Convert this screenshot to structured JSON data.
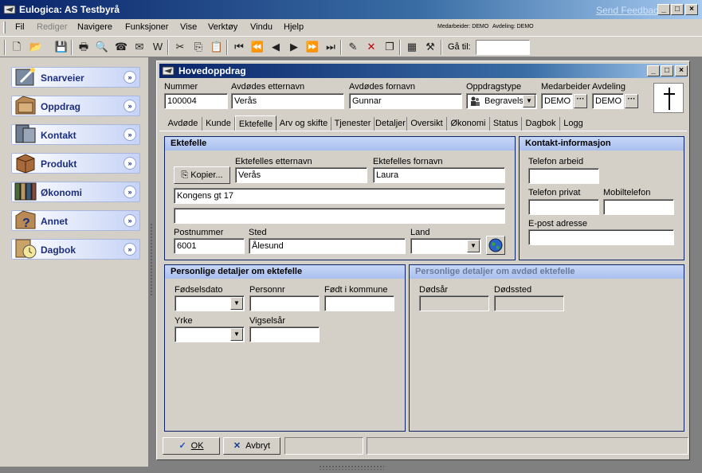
{
  "window": {
    "title": "Eulogica: AS Testbyrå",
    "feedback_link": "Send Feedback"
  },
  "menu": {
    "items": [
      "Fil",
      "Rediger",
      "Navigere",
      "Funksjoner",
      "Vise",
      "Verktøy",
      "Vindu",
      "Hjelp"
    ],
    "medarbeider_status": "Medarbeider: DEMO",
    "avdeling_status": "Avdeling: DEMO"
  },
  "toolbar": {
    "goto_label": "Gå til:",
    "goto_value": ""
  },
  "nav": {
    "items": [
      "Snarveier",
      "Oppdrag",
      "Kontakt",
      "Produkt",
      "Økonomi",
      "Annet",
      "Dagbok"
    ]
  },
  "child": {
    "title": "Hovedoppdrag",
    "header": {
      "nummer_label": "Nummer",
      "nummer_value": "100004",
      "etternavn_label": "Avdødes etternavn",
      "etternavn_value": "Verås",
      "fornavn_label": "Avdødes fornavn",
      "fornavn_value": "Gunnar",
      "oppdragstype_label": "Oppdragstype",
      "oppdragstype_value": "Begravels",
      "medarbeider_label": "Medarbeider",
      "medarbeider_value": "DEMO",
      "avdeling_label": "Avdeling",
      "avdeling_value": "DEMO",
      "dots": "···"
    },
    "tabs": [
      "Avdøde",
      "Kunde",
      "Ektefelle",
      "Arv og skifte",
      "Tjenester",
      "Detaljer",
      "Oversikt",
      "Økonomi",
      "Status",
      "Dagbok",
      "Logg"
    ],
    "active_tab": "Ektefelle",
    "ektefelle": {
      "heading": "Ektefelle",
      "kopier_button": "Kopier...",
      "etternavn_label": "Ektefelles etternavn",
      "etternavn_value": "Verås",
      "fornavn_label": "Ektefelles fornavn",
      "fornavn_value": "Laura",
      "adresse1": "Kongens gt 17",
      "adresse2": "",
      "postnummer_label": "Postnummer",
      "postnummer_value": "6001",
      "sted_label": "Sted",
      "sted_value": "Ålesund",
      "land_label": "Land",
      "land_value": ""
    },
    "kontakt": {
      "heading": "Kontakt-informasjon",
      "telefon_arbeid_label": "Telefon arbeid",
      "telefon_arbeid_value": "",
      "telefon_privat_label": "Telefon privat",
      "telefon_privat_value": "",
      "mobil_label": "Mobiltelefon",
      "mobil_value": "",
      "epost_label": "E-post adresse",
      "epost_value": ""
    },
    "personlige": {
      "heading": "Personlige detaljer om ektefelle",
      "fodselsdato_label": "Fødselsdato",
      "fodselsdato_value": "",
      "personnr_label": "Personnr",
      "personnr_value": "",
      "fodt_kommune_label": "Født i kommune",
      "fodt_kommune_value": "",
      "yrke_label": "Yrke",
      "yrke_value": "",
      "vigselsar_label": "Vigselsår",
      "vigselsar_value": ""
    },
    "avdod": {
      "heading": "Personlige detaljer om avdød ektefelle",
      "dodsar_label": "Dødsår",
      "dodsar_value": "",
      "dodssted_label": "Dødssted",
      "dodssted_value": ""
    },
    "footer": {
      "ok_label": "OK",
      "avbryt_label": "Avbryt"
    }
  },
  "colors": {
    "titlebar_dark": "#0a246a",
    "titlebar_light": "#a6caf0",
    "face": "#d4d0c8",
    "group_border": "#0a246a",
    "nav_text": "#1c2d7a"
  }
}
